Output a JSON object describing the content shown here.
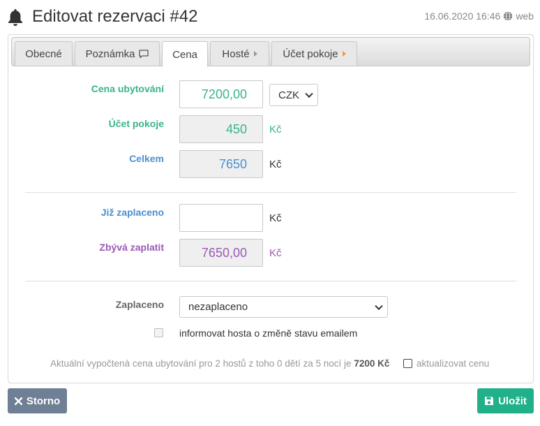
{
  "header": {
    "title": "Editovat rezervaci #42",
    "datetime": "16.06.2020 16:46",
    "source": "web"
  },
  "tabs": [
    {
      "label": "Obecné",
      "icon": null,
      "active": false
    },
    {
      "label": "Poznámka",
      "icon": "message-icon",
      "active": false
    },
    {
      "label": "Cena",
      "icon": null,
      "active": true
    },
    {
      "label": "Hosté",
      "icon": "caret-right-icon",
      "active": false
    },
    {
      "label": "Účet pokoje",
      "icon": "caret-right-icon",
      "active": false
    }
  ],
  "form": {
    "price_label": "Cena ubytování",
    "price_value": "7200,00",
    "currency_selected": "CZK",
    "room_account_label": "Účet pokoje",
    "room_account_value": "450",
    "room_account_unit": "Kč",
    "total_label": "Celkem",
    "total_value": "7650",
    "total_unit": "Kč",
    "paid_label": "Již zaplaceno",
    "paid_value": "",
    "paid_unit": "Kč",
    "remaining_label": "Zbývá zaplatit",
    "remaining_value": "7650,00",
    "remaining_unit": "Kč",
    "payment_status_label": "Zaplaceno",
    "payment_status_selected": "nezaplaceno",
    "notify_label": "informovat hosta o změně stavu emailem",
    "notify_checked": false
  },
  "footnote": {
    "text": "Aktuální vypočtená cena ubytování pro 2 hostů z toho 0 dětí za 5 nocí je",
    "amount": "7200 Kč",
    "update_label": "aktualizovat cenu",
    "update_checked": false
  },
  "buttons": {
    "cancel": "Storno",
    "save": "Uložit"
  },
  "colors": {
    "teal": "#3bb28e",
    "blue": "#4a90d0",
    "purple": "#9b59b6",
    "cancel_bg": "#6f7f95",
    "save_bg": "#20b08a",
    "accent_orange": "#f39c33"
  }
}
